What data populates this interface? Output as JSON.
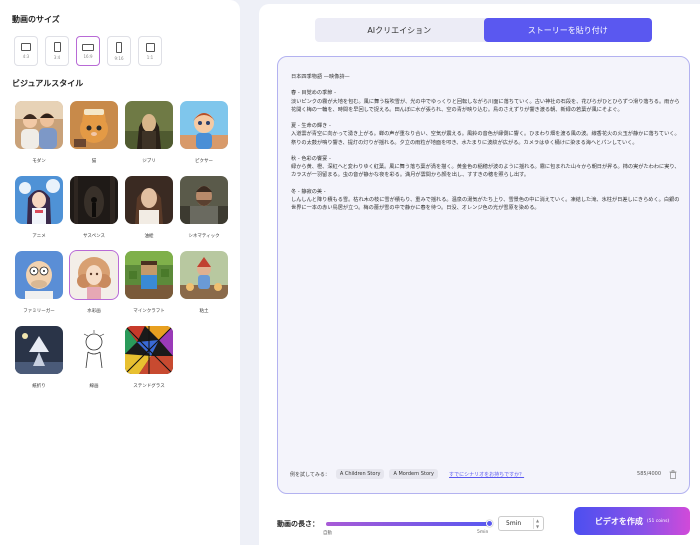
{
  "left": {
    "size_title": "動画のサイズ",
    "sizes": [
      {
        "label": "4:3"
      },
      {
        "label": "3:4"
      },
      {
        "label": "16:9",
        "selected": true
      },
      {
        "label": "9:16"
      },
      {
        "label": "1:1"
      }
    ],
    "style_title": "ビジュアルスタイル",
    "styles": [
      {
        "label": "モダン"
      },
      {
        "label": "猫"
      },
      {
        "label": "ジブリ"
      },
      {
        "label": "ピクサー"
      },
      {
        "label": "アニメ"
      },
      {
        "label": "サスペンス"
      },
      {
        "label": "油絵"
      },
      {
        "label": "シネマティック"
      },
      {
        "label": "ファミリーガー"
      },
      {
        "label": "水彩画",
        "selected": true
      },
      {
        "label": "マインクラフト"
      },
      {
        "label": "粘土"
      },
      {
        "label": "紙折り"
      },
      {
        "label": "線画"
      },
      {
        "label": "ステンドグラス"
      }
    ]
  },
  "tabs": [
    {
      "label": "AIクリエイション",
      "active": false
    },
    {
      "label": "ストーリーを貼り付け",
      "active": true
    }
  ],
  "editor": {
    "story": "日本四季物語 —映像詩—\n\n春 - 目覚めの季節 -\n淡いピンクの霧が大地を包む。風に舞う桜吹雪が、光の中でゆっくりと回転しながら川面に落ちていく。古い神社の石段を、花びらがひとひらずつ滑り落ちる。雨から花開く梅の一輪を、時間を早回しで捉える。田んぼに水が張られ、空の青が映り込む。鳥のさえずりが響き渡る朝、新緑の若葉が風にそよぐ。\n\n夏 - 生命の輝き -\n入道雲が青空に向かって湧き上がる。蝉の声が重なり合い、空気が震える。風鈴の音色が縁側に響く。ひまわり畑を渡る風の波。線香花火の火玉が静かに落ちていく。祭りの太鼓が鳴り響き、提灯の灯りが揺れる。夕立の雨粒が地面を叩き、水たまりに波紋が広がる。カメラはゆく桶けに染まる海へとパンしていく。\n\n秋 - 色彩の饗宴 -\n緑から黄、橙、深紅へと変わりゆく紅葉。風に舞う落ち葉が渦を描く。黄金色の稲穂が波のように揺れる。霧に包まれた山々から朝日が昇る。柿の実がたわわに実り、カラスが一羽留まる。虫の音が静かな夜を彩る。満月が雲間から顔を出し、すすきの穂を照らし出す。\n\n冬 - 静寂の美 -\nしんしんと降り積もる雪。枯れ木の枝に雪が積もり、重みで揺れる。温泉の湯気がたち上り、雪景色の中に消えていく。凍結した滝、氷柱が日差しにきらめく。白銀の世界に一本の赤い鳥居が立つ。梅の蕾が雪の中で静かに春を待つ。日没、オレンジ色の光が雪原を染める。",
    "try_label": "例を試してみる：",
    "examples": [
      "A Children Story",
      "A Mordern Story"
    ],
    "script_link": "すでにシナリオをお持ちですか？",
    "char_count": "585/4000"
  },
  "bottom": {
    "length_label": "動画の長さ：",
    "tick_min": "自動",
    "tick_max": "5min",
    "duration_value": "5min",
    "slider_fraction": 1.0,
    "create_label": "ビデオを作成",
    "create_coins": "(51 coins)"
  },
  "colors": {
    "accent": "#5a58f0",
    "selected_outline": "#b86ad6"
  }
}
